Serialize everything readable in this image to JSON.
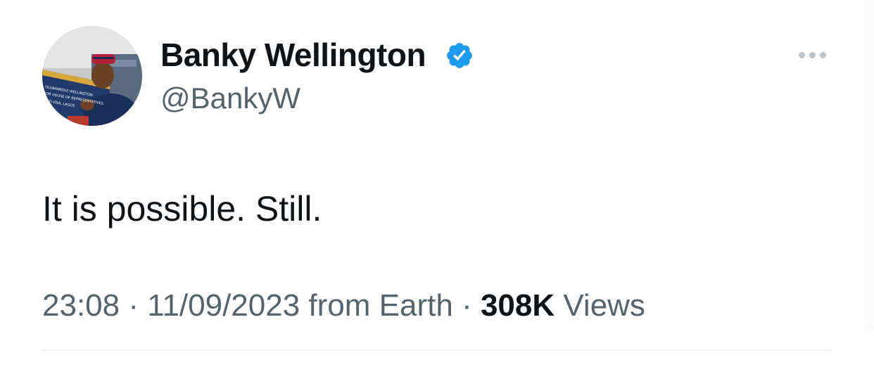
{
  "author": {
    "display_name": "Banky Wellington",
    "handle": "@BankyW",
    "verified": true,
    "avatar_icon": "profile-photo"
  },
  "tweet": {
    "text": "It is possible. Still."
  },
  "meta": {
    "time": "23:08",
    "separator": "·",
    "date": "11/09/2023",
    "source": "from Earth",
    "views_count": "308K",
    "views_label": "Views"
  },
  "colors": {
    "verified_blue": "#1d9bf0",
    "primary_text": "#0f1419",
    "secondary_text": "#536471"
  },
  "icons": {
    "more": "more-options-icon",
    "verified": "verified-badge-icon"
  }
}
